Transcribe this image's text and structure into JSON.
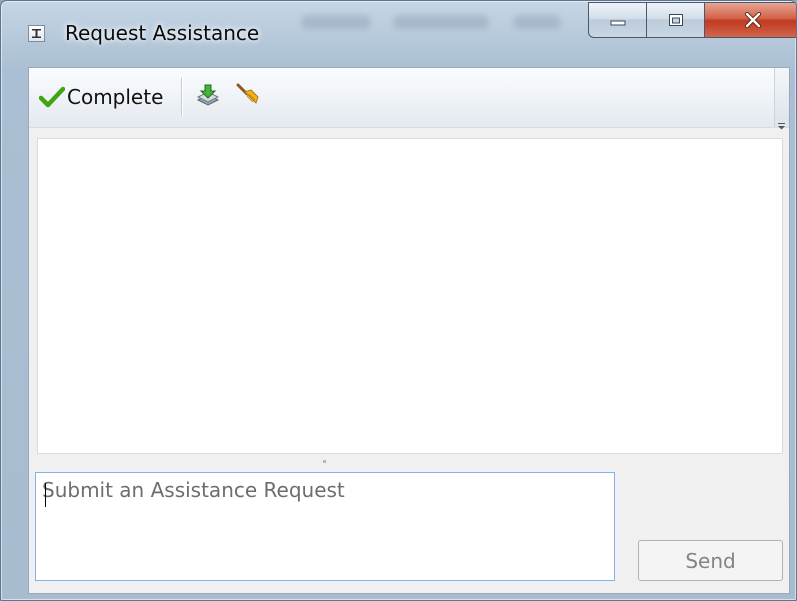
{
  "window": {
    "title": "Request Assistance",
    "icon": "app-icon",
    "controls": {
      "minimize_icon": "minimize-icon",
      "maximize_icon": "maximize-icon",
      "close_icon": "close-icon"
    }
  },
  "toolbar": {
    "complete_label": "Complete",
    "complete_icon": "checkmark-icon",
    "items": [
      {
        "name": "download-stack-icon"
      },
      {
        "name": "broom-icon"
      }
    ]
  },
  "conversation": {
    "messages": []
  },
  "request": {
    "placeholder": "Submit an Assistance Request",
    "value": ""
  },
  "send": {
    "label": "Send",
    "enabled": false
  },
  "colors": {
    "accent_check": "#3fa512",
    "input_border": "#7eb4ea",
    "close_button": "#c8452a"
  }
}
